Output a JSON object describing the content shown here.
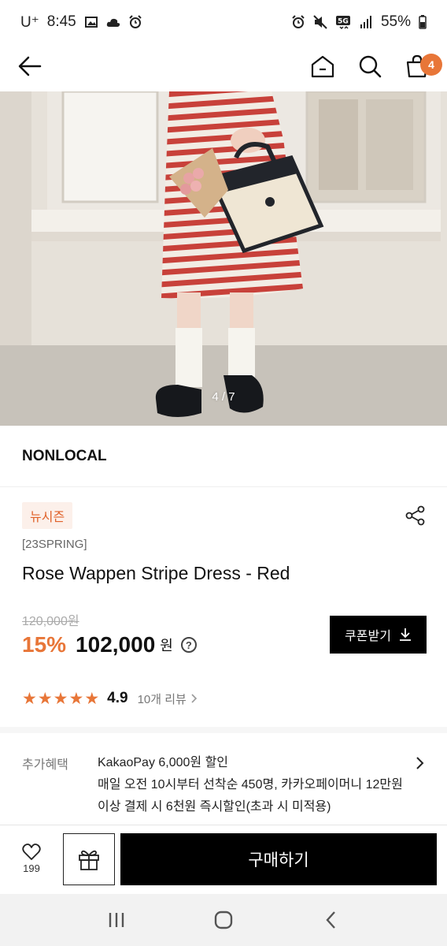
{
  "status_bar": {
    "carrier": "U⁺",
    "time": "8:45",
    "network": "5G",
    "battery": "55%"
  },
  "header": {
    "back_icon": "back-arrow-icon",
    "home_icon": "home-icon",
    "search_icon": "search-icon",
    "cart_icon": "shopping-bag-icon",
    "cart_count": "4"
  },
  "gallery": {
    "counter": "4 / 7"
  },
  "brand": {
    "name": "NONLOCAL"
  },
  "product": {
    "tag": "뉴시즌",
    "season": "[23SPRING]",
    "name": "Rose Wappen Stripe Dress - Red",
    "original_price": "120,000원",
    "discount": "15%",
    "price": "102,000",
    "currency": "원",
    "help": "?",
    "coupon_label": "쿠폰받기",
    "rating": "4.9",
    "stars": 5,
    "review_link": "10개 리뷰"
  },
  "benefit": {
    "label": "추가혜택",
    "line1": "KakaoPay 6,000원 할인",
    "line2": "매일 오전 10시부터 선착순 450명, 카카오페이머니 12만원 이상 결제 시 6천원 즉시할인(초과 시 미적용)"
  },
  "actions": {
    "like_count": "199",
    "buy_label": "구매하기"
  },
  "colors": {
    "accent": "#e87638",
    "tag_bg": "#fcf0ea",
    "button_bg": "#000000"
  }
}
